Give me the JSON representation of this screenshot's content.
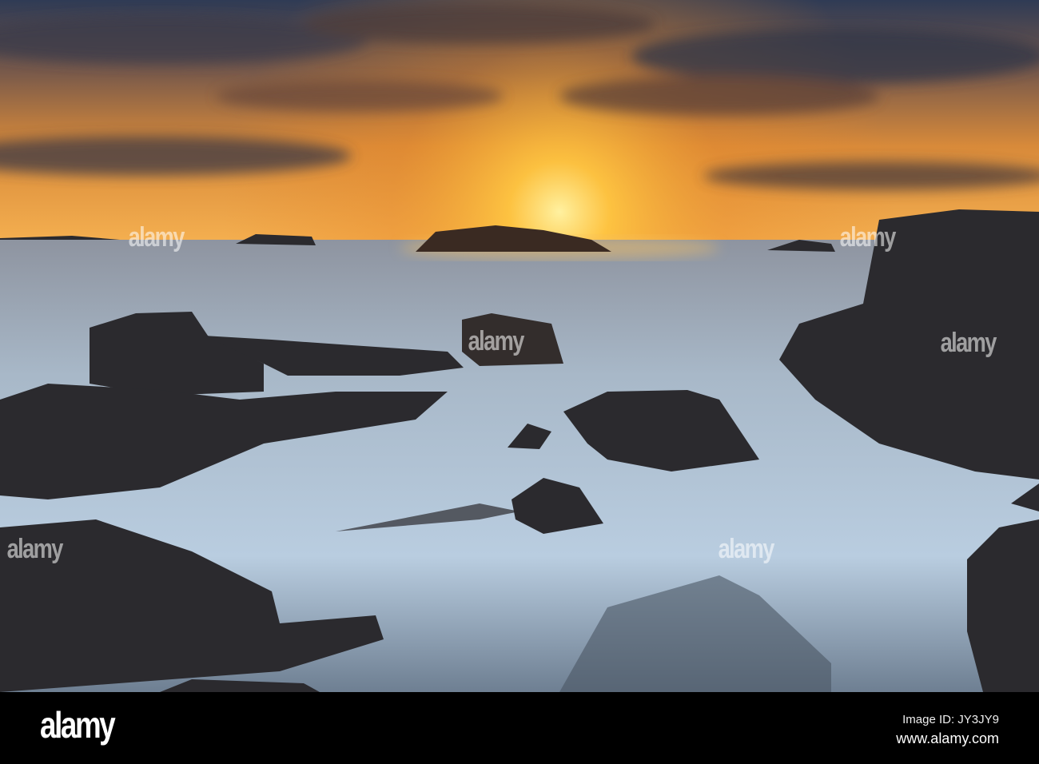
{
  "watermark": {
    "text": "alamy"
  },
  "footer": {
    "logo": "alamy",
    "image_id": "Image ID: JY3JY9",
    "website": "www.alamy.com"
  },
  "colors": {
    "sky_top": "#2d3a52",
    "sun": "#ffd24a",
    "horizon": "#f2a23a",
    "sea": "#a9c0d6",
    "rock": "#2a2a2e"
  }
}
